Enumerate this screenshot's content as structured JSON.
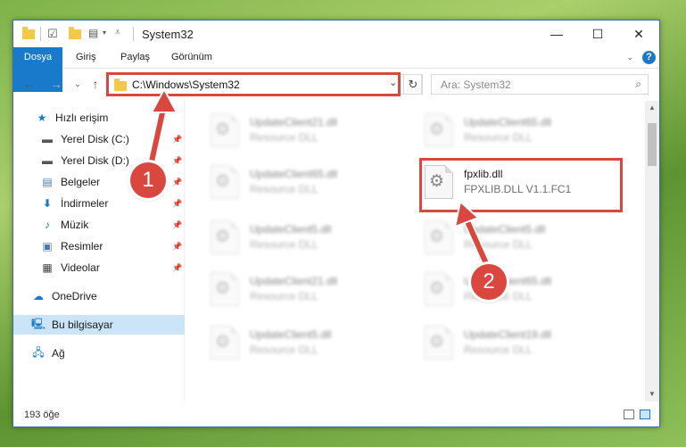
{
  "window": {
    "title": "System32",
    "controls": {
      "minimize": "—",
      "maximize": "☐",
      "close": "✕"
    }
  },
  "ribbon": {
    "tabs": [
      {
        "label": "Dosya",
        "active": true
      },
      {
        "label": "Giriş"
      },
      {
        "label": "Paylaş"
      },
      {
        "label": "Görünüm"
      }
    ],
    "help": "?"
  },
  "address": {
    "path": "C:\\Windows\\System32",
    "search_placeholder": "Ara: System32"
  },
  "sidebar": {
    "items": [
      {
        "label": "Hızlı erişim",
        "icon": "star-icon",
        "color": "#1979ca"
      },
      {
        "label": "Yerel Disk (C:)",
        "icon": "drive-icon",
        "pinned": true
      },
      {
        "label": "Yerel Disk (D:)",
        "icon": "drive-icon",
        "pinned": true
      },
      {
        "label": "Belgeler",
        "icon": "document-icon",
        "pinned": true
      },
      {
        "label": "İndirmeler",
        "icon": "download-icon",
        "pinned": true
      },
      {
        "label": "Müzik",
        "icon": "music-icon",
        "pinned": true
      },
      {
        "label": "Resimler",
        "icon": "pictures-icon",
        "pinned": true
      },
      {
        "label": "Videolar",
        "icon": "video-icon",
        "pinned": true
      },
      {
        "label": "OneDrive",
        "icon": "cloud-icon"
      },
      {
        "label": "Bu bilgisayar",
        "icon": "computer-icon",
        "selected": true
      },
      {
        "label": "Ağ",
        "icon": "network-icon"
      }
    ]
  },
  "files": [
    {
      "name": "UpdateClient21.dll",
      "type": "Resource DLL",
      "blurred": true
    },
    {
      "name": "UpdateClient65.dll",
      "type": "Resource DLL",
      "blurred": true
    },
    {
      "name": "UpdateClient65.dll",
      "type": "Resource DLL",
      "blurred": true
    },
    {
      "name": "fpxlib.dll",
      "type": "FPXLIB.DLL V1.1.FC1",
      "blurred": false,
      "highlighted": true
    },
    {
      "name": "UpdateClient5.dll",
      "type": "Resource DLL",
      "blurred": true
    },
    {
      "name": "UpdateClient5.dll",
      "type": "Resource DLL",
      "blurred": true
    },
    {
      "name": "UpdateClient21.dll",
      "type": "Resource DLL",
      "blurred": true
    },
    {
      "name": "UpdateClient65.dll",
      "type": "Resource DLL",
      "blurred": true
    },
    {
      "name": "UpdateClient5.dll",
      "type": "Resource DLL",
      "blurred": true
    },
    {
      "name": "UpdateClient19.dll",
      "type": "Resource DLL",
      "blurred": true
    }
  ],
  "status": {
    "count_text": "193 öğe"
  },
  "annotations": {
    "callout_1": "1",
    "callout_2": "2",
    "color": "#d9473f"
  }
}
